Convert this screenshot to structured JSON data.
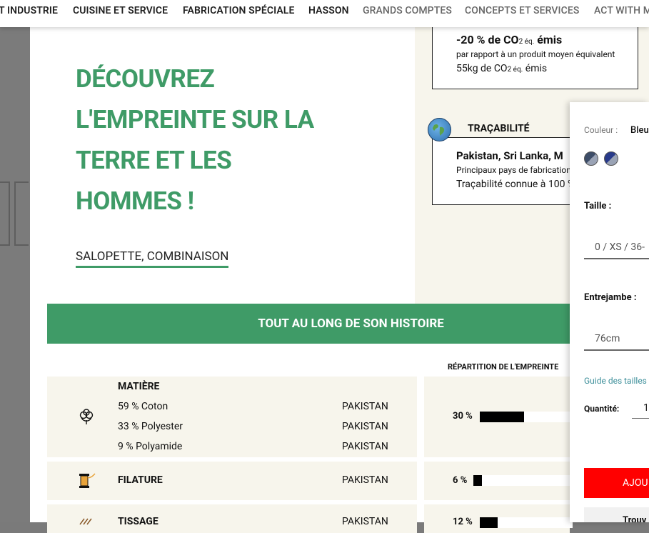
{
  "nav": {
    "items": [
      {
        "label": "T INDUSTRIE"
      },
      {
        "label": "CUISINE ET SERVICE"
      },
      {
        "label": "FABRICATION SPÉCIALE"
      },
      {
        "label": "HASSON"
      },
      {
        "label": "GRANDS COMPTES"
      },
      {
        "label": "CONCEPTS ET SERVICES"
      },
      {
        "label": "ACT WITH M"
      }
    ]
  },
  "hero": {
    "headline_lines": [
      "DÉCOUVREZ",
      "L'EMPREINTE SUR LA",
      "TERRE ET LES",
      "HOMMES !"
    ],
    "category": "SALOPETTE, COMBINAISON"
  },
  "co2": {
    "value": "-20 % de CO",
    "value_sub": "2 éq.",
    "value_suffix": " émis",
    "desc": "par rapport à un produit moyen équivalent",
    "amount": "55kg de CO",
    "amount_sub": "2 éq.",
    "amount_suffix": " émis"
  },
  "tracability": {
    "label": "TRAÇABILITÉ",
    "countries": "Pakistan, Sri Lanka, M",
    "desc": "Principaux pays de fabrication",
    "sub": "Traçabilité connue à 100 %"
  },
  "banner": {
    "label": "TOUT AU LONG DE SON HISTOIRE"
  },
  "repartition_label": "RÉPARTITION DE L'EMPREINTE",
  "steps": [
    {
      "name": "MATIÈRE",
      "icon": "cotton-icon",
      "lines": [
        {
          "text": "59 % Coton",
          "country": "PAKISTAN"
        },
        {
          "text": "33 % Polyester",
          "country": "PAKISTAN"
        },
        {
          "text": "9 % Polyamide",
          "country": "PAKISTAN"
        }
      ],
      "pct_label": "30 %",
      "pct": 30
    },
    {
      "name": "FILATURE",
      "icon": "spool-icon",
      "country": "PAKISTAN",
      "pct_label": "6 %",
      "pct": 6
    },
    {
      "name": "TISSAGE",
      "icon": "weaving-icon",
      "country": "PAKISTAN",
      "pct_label": "12 %",
      "pct": 12
    }
  ],
  "panel": {
    "color_label": "Couleur :",
    "color_value": "Bleu",
    "swatches": [
      {
        "name": "blue-gray",
        "color": "#3d4d68"
      },
      {
        "name": "blue-navy",
        "color": "#283a8a"
      }
    ],
    "size_label": "Taille :",
    "size_value": "0 / XS / 36-",
    "inseam_label": "Entrejambe :",
    "inseam_value": "76cm",
    "guide_label": "Guide des tailles",
    "qty_label": "Quantité:",
    "qty_value": "1",
    "add_label": "AJOU",
    "find_label": "Trouv"
  },
  "colors": {
    "accent": "#3f9b67",
    "button": "#ff0000",
    "beige": "#f7f5ec"
  }
}
